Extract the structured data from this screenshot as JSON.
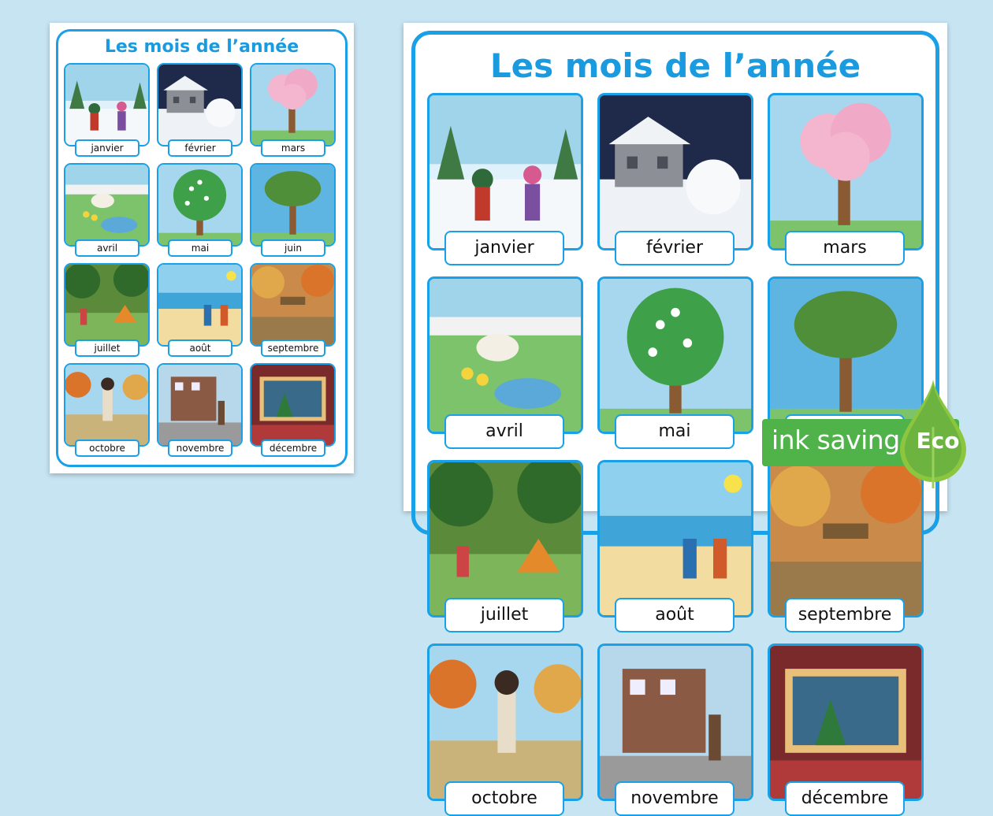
{
  "title": "Les mois de l’année",
  "months": [
    "janvier",
    "février",
    "mars",
    "avril",
    "mai",
    "juin",
    "juillet",
    "août",
    "septembre",
    "octobre",
    "novembre",
    "décembre"
  ],
  "eco_badge": {
    "text": "ink saving",
    "label": "Eco"
  },
  "colors": {
    "accent": "#1aa0e6",
    "background": "#c6e4f2",
    "eco": "#4fb34a"
  }
}
